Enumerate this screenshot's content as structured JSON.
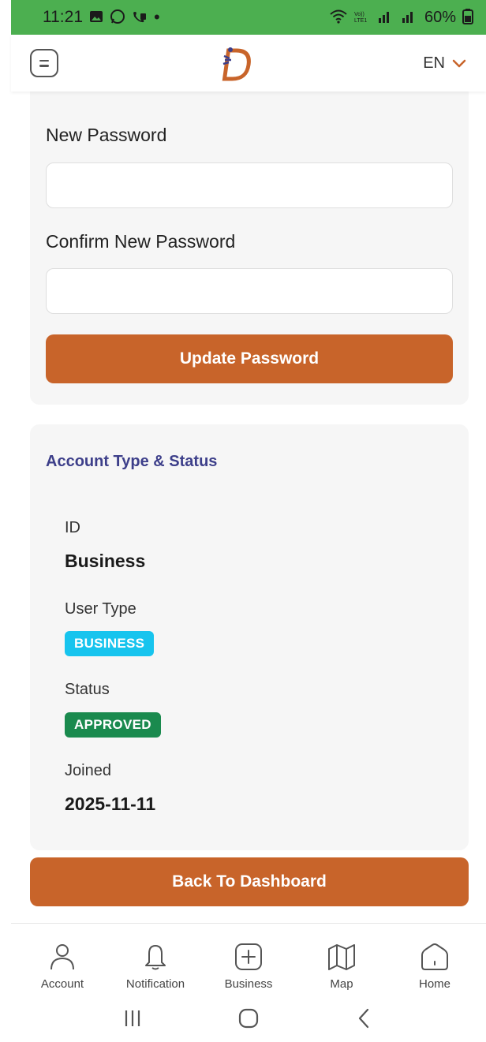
{
  "status_bar": {
    "time": "11:21",
    "battery": "60%",
    "dot": "•",
    "bg_color": "#4caf50"
  },
  "header": {
    "language": "EN",
    "accent_color": "#c8642a"
  },
  "password_form": {
    "new_password_label": "New Password",
    "new_password_value": "",
    "confirm_password_label": "Confirm New Password",
    "confirm_password_value": "",
    "update_button": "Update Password"
  },
  "account": {
    "section_title": "Account Type & Status",
    "id_label": "ID",
    "id_value": "Business",
    "user_type_label": "User Type",
    "user_type_badge": "BUSINESS",
    "status_label": "Status",
    "status_badge": "APPROVED",
    "joined_label": "Joined",
    "joined_value": "2025-11-11"
  },
  "back_button": "Back To Dashboard",
  "bottom_nav": {
    "items": [
      {
        "label": "Account",
        "icon": "person-icon"
      },
      {
        "label": "Notification",
        "icon": "bell-icon"
      },
      {
        "label": "Business",
        "icon": "plus-square-icon"
      },
      {
        "label": "Map",
        "icon": "map-icon"
      },
      {
        "label": "Home",
        "icon": "home-icon"
      }
    ]
  }
}
